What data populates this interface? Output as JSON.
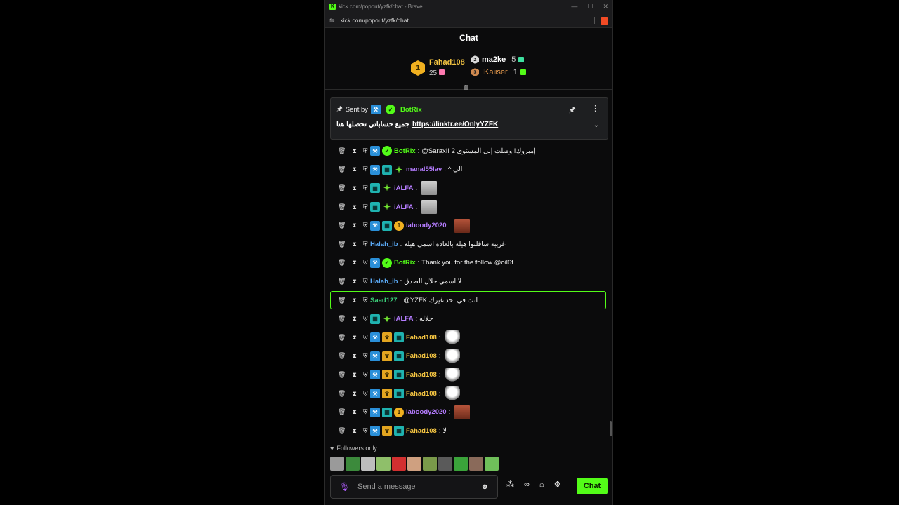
{
  "browser": {
    "tab_title": "kick.com/popout/yzfk/chat - Brave",
    "url": "kick.com/popout/yzfk/chat",
    "controls": {
      "minimize": "—",
      "maximize": "☐",
      "close": "✕"
    }
  },
  "chat": {
    "header_title": "Chat",
    "leaderboard": {
      "first": {
        "rank": "1",
        "name": "Fahad108",
        "count": "25"
      },
      "second": {
        "rank": "2",
        "name": "ma2ke",
        "count": "5"
      },
      "third": {
        "rank": "3",
        "name": "IKaiiser",
        "count": "1"
      }
    },
    "pinned": {
      "sent_by_label": "Sent by",
      "sender": "BotRix",
      "message_text": "جميع حساباتي تحصلها هنا",
      "link": "https://linktr.ee/OnlyYZFK"
    },
    "messages": [
      {
        "badges": [
          "blue",
          "verified"
        ],
        "user": "BotRix",
        "user_color": "#53fc18",
        "text": "@SaraxII إمبروك! وصلت إلى المستوى 2",
        "emote": ""
      },
      {
        "badges": [
          "blue",
          "teal",
          "star"
        ],
        "user": "manal55lav",
        "user_color": "#b57cff",
        "text": "^ الي",
        "emote": ""
      },
      {
        "badges": [
          "teal",
          "star"
        ],
        "user": "iALFA",
        "user_color": "#b57cff",
        "text": "",
        "emote": "face"
      },
      {
        "badges": [
          "teal",
          "star"
        ],
        "user": "iALFA",
        "user_color": "#b57cff",
        "text": "",
        "emote": "face"
      },
      {
        "badges": [
          "blue",
          "teal",
          "gold"
        ],
        "user": "iaboody2020",
        "user_color": "#b57cff",
        "text": "",
        "emote": "red"
      },
      {
        "badges": [],
        "user": "Halah_ib",
        "user_color": "#5aa9f5",
        "text": "غريبه ساقلتوا هيله بالعاده اسمي هيله",
        "emote": ""
      },
      {
        "badges": [
          "blue",
          "verified"
        ],
        "user": "BotRix",
        "user_color": "#53fc18",
        "text": "Thank you for the follow @oil6f",
        "emote": ""
      },
      {
        "badges": [],
        "user": "Halah_ib",
        "user_color": "#5aa9f5",
        "text": "لا اسمي حلال الصدق",
        "emote": ""
      },
      {
        "badges": [],
        "user": "Saad127",
        "user_color": "#3cd07a",
        "text": "@YZFK انت في احد غيرك",
        "emote": "",
        "highlight": true
      },
      {
        "badges": [
          "teal",
          "star"
        ],
        "user": "iALFA",
        "user_color": "#b57cff",
        "text": "حلاله",
        "emote": ""
      },
      {
        "badges": [
          "blue",
          "crown",
          "teal"
        ],
        "user": "Fahad108",
        "user_color": "#f5c542",
        "text": "",
        "emote": "helm"
      },
      {
        "badges": [
          "blue",
          "crown",
          "teal"
        ],
        "user": "Fahad108",
        "user_color": "#f5c542",
        "text": "",
        "emote": "helm"
      },
      {
        "badges": [
          "blue",
          "crown",
          "teal"
        ],
        "user": "Fahad108",
        "user_color": "#f5c542",
        "text": "",
        "emote": "helm"
      },
      {
        "badges": [
          "blue",
          "crown",
          "teal"
        ],
        "user": "Fahad108",
        "user_color": "#f5c542",
        "text": "",
        "emote": "helm"
      },
      {
        "badges": [
          "blue",
          "teal",
          "gold"
        ],
        "user": "iaboody2020",
        "user_color": "#b57cff",
        "text": "",
        "emote": "red"
      },
      {
        "badges": [
          "blue",
          "crown",
          "teal"
        ],
        "user": "Fahad108",
        "user_color": "#f5c542",
        "text": "لا",
        "emote": ""
      }
    ],
    "followers_only_label": "Followers only",
    "emote_strip_colors": [
      "#9a9a9a",
      "#3c8a3c",
      "#bdbdbd",
      "#8fbf6a",
      "#d23030",
      "#cfa080",
      "#7a9a4a",
      "#5a5a5a",
      "#3aa33a",
      "#8a6a5a",
      "#6fbf5a"
    ],
    "input_placeholder": "Send a message",
    "send_button": "Chat"
  },
  "colors": {
    "accent": "#53fc18",
    "background": "#0b0b0c"
  }
}
